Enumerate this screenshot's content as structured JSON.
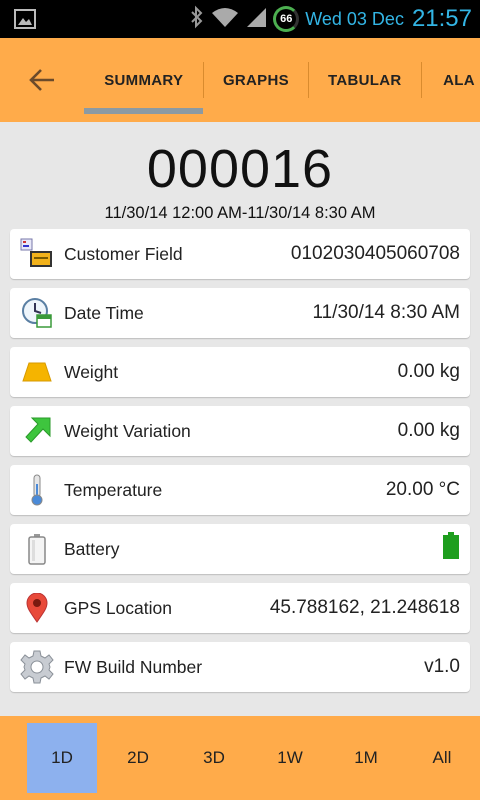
{
  "status_bar": {
    "date": "Wed 03 Dec",
    "time": "21:57",
    "battery_level": "66"
  },
  "tabs": [
    {
      "label": "SUMMARY",
      "active": true
    },
    {
      "label": "GRAPHS",
      "active": false
    },
    {
      "label": "TABULAR",
      "active": false
    },
    {
      "label": "ALA",
      "active": false
    }
  ],
  "header": {
    "device_id": "000016",
    "range": "11/30/14 12:00 AM-11/30/14 8:30 AM"
  },
  "rows": [
    {
      "label": "Customer Field",
      "value": "0102030405060708",
      "icon": "customer-field-icon"
    },
    {
      "label": "Date Time",
      "value": "11/30/14 8:30 AM",
      "icon": "clock-calendar-icon"
    },
    {
      "label": "Weight",
      "value": "0.00 kg",
      "icon": "weight-icon"
    },
    {
      "label": "Weight Variation",
      "value": "0.00 kg",
      "icon": "arrow-up-left-icon"
    },
    {
      "label": "Temperature",
      "value": "20.00 °C",
      "icon": "thermometer-icon"
    },
    {
      "label": "Battery",
      "value": "",
      "icon": "battery-icon",
      "battery_level": 1.0
    },
    {
      "label": "GPS Location",
      "value": "45.788162, 21.248618",
      "icon": "map-pin-icon"
    },
    {
      "label": "FW Build Number",
      "value": "v1.0",
      "icon": "gear-icon"
    }
  ],
  "periods": [
    {
      "label": "1D",
      "selected": true
    },
    {
      "label": "2D",
      "selected": false
    },
    {
      "label": "3D",
      "selected": false
    },
    {
      "label": "1W",
      "selected": false
    },
    {
      "label": "1M",
      "selected": false
    },
    {
      "label": "All",
      "selected": false
    }
  ],
  "colors": {
    "accent": "#ffab4a",
    "selected_period": "#8db1ee",
    "battery_full": "#1e9e1e"
  }
}
